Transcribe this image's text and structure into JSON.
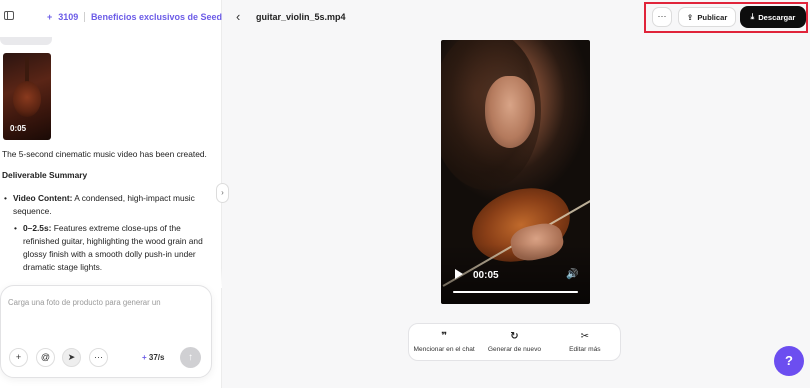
{
  "sidebar": {
    "credits": {
      "plus": "+",
      "count": "3109",
      "promo": "Beneficios exclusivos de Seed"
    }
  },
  "chat": {
    "thumbnail_duration": "0:05",
    "message": "The 5-second cinematic music video has been created.",
    "heading": "Deliverable Summary",
    "bullets": [
      {
        "label": "Video Content:",
        "text": " A condensed, high-impact music sequence."
      },
      {
        "label": "0–2.5s:",
        "text": " Features extreme close-ups of the refinished guitar, highlighting the wood grain and glossy finish with a smooth dolly push-in under dramatic stage lights."
      }
    ]
  },
  "composer": {
    "placeholder": "Carga una foto de producto para generar un",
    "cost": "37/s",
    "cost_plus": "+",
    "buttons": {
      "add": "+",
      "mention": "@",
      "select": "➤",
      "more": "···"
    }
  },
  "header": {
    "back_icon": "‹",
    "filename": "guitar_violin_5s.mp4",
    "more": "···",
    "publish": "Publicar",
    "download": "Descargar",
    "highlight_color": "#e0243a"
  },
  "video": {
    "time": "00:05",
    "progress": 1.0
  },
  "toolbar": {
    "items": [
      {
        "icon": "quote-icon",
        "glyph": "❞",
        "label": "Mencionar en el chat"
      },
      {
        "icon": "regenerate-icon",
        "glyph": "↻",
        "label": "Generar de nuevo"
      },
      {
        "icon": "scissors-icon",
        "glyph": "✂",
        "label": "Editar más"
      }
    ]
  },
  "help": {
    "glyph": "?"
  },
  "colors": {
    "accent": "#6c5ce7",
    "help": "#6c4ef0",
    "download_bg": "#0d0d0d"
  }
}
